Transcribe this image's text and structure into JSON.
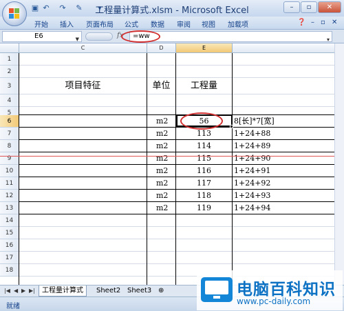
{
  "title": "工程量计算式.xlsm - Microsoft Excel",
  "window_buttons": {
    "minimize": "–",
    "restore": "▫",
    "close": "✕"
  },
  "menu": {
    "items": [
      "开始",
      "插入",
      "页面布局",
      "公式",
      "数据",
      "审阅",
      "视图",
      "加载项"
    ],
    "right_icons": [
      "help-icon",
      "minimize-ribbon-icon",
      "restore-icon",
      "close-icon"
    ]
  },
  "formula_bar": {
    "name_box": "E6",
    "fx_label": "fx",
    "formula": "=ww"
  },
  "grid": {
    "columns": [
      "C",
      "D",
      "E"
    ],
    "selected_column": "E",
    "row_numbers": [
      "1",
      "2",
      "3",
      "4",
      "5",
      "6",
      "7",
      "8",
      "9",
      "10",
      "11",
      "12",
      "13",
      "14",
      "15",
      "16",
      "17",
      "18"
    ],
    "selected_row": "6",
    "header_row": {
      "item": "项目特征",
      "unit": "单位",
      "qty": "工程量"
    },
    "data_rows": [
      {
        "row": "6",
        "unit": "m2",
        "qty": "56",
        "formula": "8[长]*7[宽]"
      },
      {
        "row": "7",
        "unit": "m2",
        "qty": "113",
        "formula": "1+24+88"
      },
      {
        "row": "8",
        "unit": "m2",
        "qty": "114",
        "formula": "1+24+89"
      },
      {
        "row": "9",
        "unit": "m2",
        "qty": "115",
        "formula": "1+24+90"
      },
      {
        "row": "10",
        "unit": "m2",
        "qty": "116",
        "formula": "1+24+91"
      },
      {
        "row": "11",
        "unit": "m2",
        "qty": "117",
        "formula": "1+24+92"
      },
      {
        "row": "12",
        "unit": "m2",
        "qty": "118",
        "formula": "1+24+93"
      },
      {
        "row": "13",
        "unit": "m2",
        "qty": "119",
        "formula": "1+24+94"
      }
    ]
  },
  "sheet_tabs": {
    "nav": [
      "|◀",
      "◀",
      "▶",
      "▶|"
    ],
    "tabs": [
      "工程量计算式",
      "Sheet2",
      "Sheet3"
    ],
    "active": "工程量计算式"
  },
  "status": "就绪",
  "watermark": {
    "title": "电脑百科知识",
    "url": "www.pc-daily.com"
  }
}
